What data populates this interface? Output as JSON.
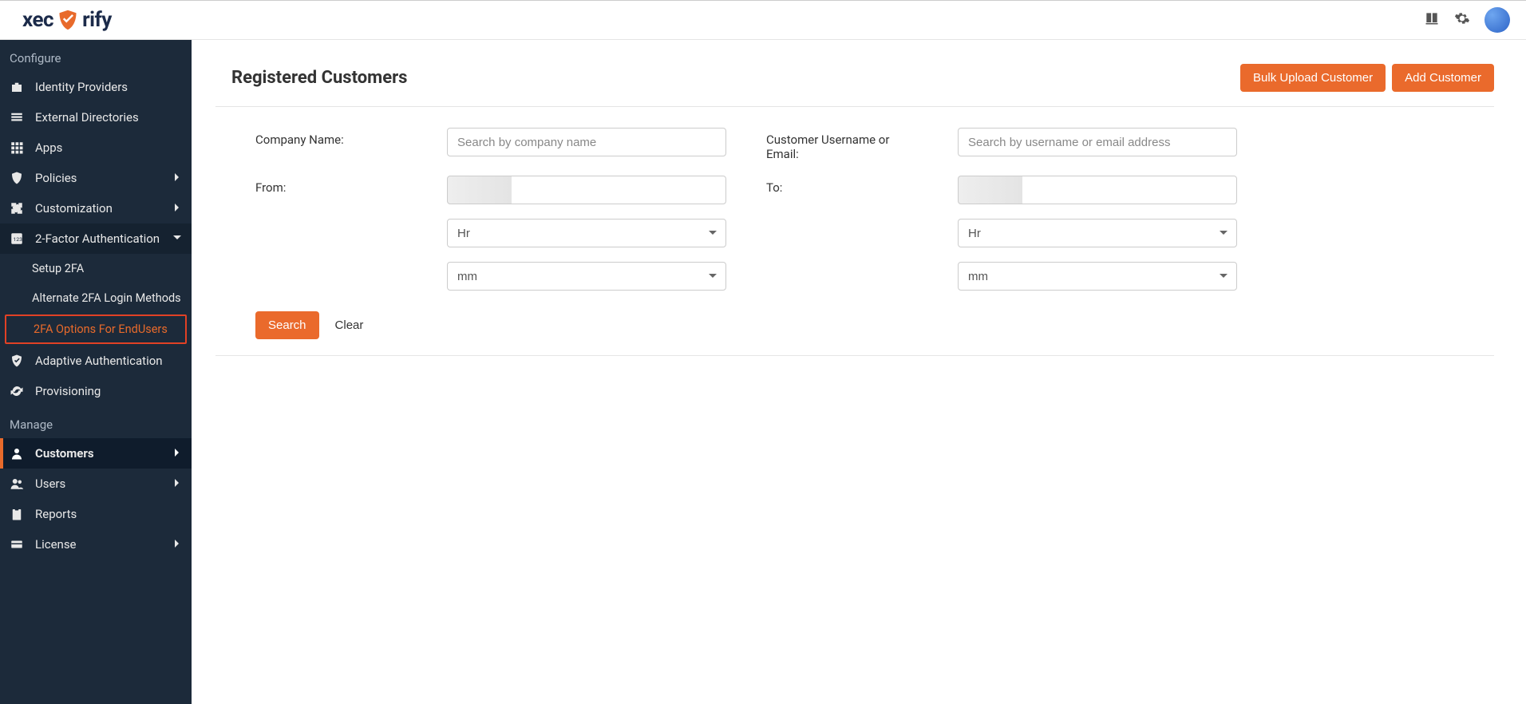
{
  "brand": {
    "text_left": "xec",
    "text_right": "rify"
  },
  "sidebar": {
    "section_configure": "Configure",
    "section_manage": "Manage",
    "identity_providers": "Identity Providers",
    "external_directories": "External Directories",
    "apps": "Apps",
    "policies": "Policies",
    "customization": "Customization",
    "two_factor": "2-Factor Authentication",
    "two_factor_sub": {
      "setup": "Setup 2FA",
      "alternate": "Alternate 2FA Login Methods",
      "options_endusers": "2FA Options For EndUsers"
    },
    "adaptive_auth": "Adaptive Authentication",
    "provisioning": "Provisioning",
    "customers": "Customers",
    "users": "Users",
    "reports": "Reports",
    "license": "License"
  },
  "page": {
    "title": "Registered Customers",
    "bulk_upload": "Bulk Upload Customer",
    "add_customer": "Add Customer"
  },
  "filters": {
    "company_label": "Company Name:",
    "company_placeholder": "Search by company name",
    "user_label": "Customer Username or Email:",
    "user_placeholder": "Search by username or email address",
    "from_label": "From:",
    "to_label": "To:",
    "from_value": "",
    "to_value": "",
    "hr_option": "Hr",
    "mm_option": "mm",
    "search": "Search",
    "clear": "Clear"
  }
}
